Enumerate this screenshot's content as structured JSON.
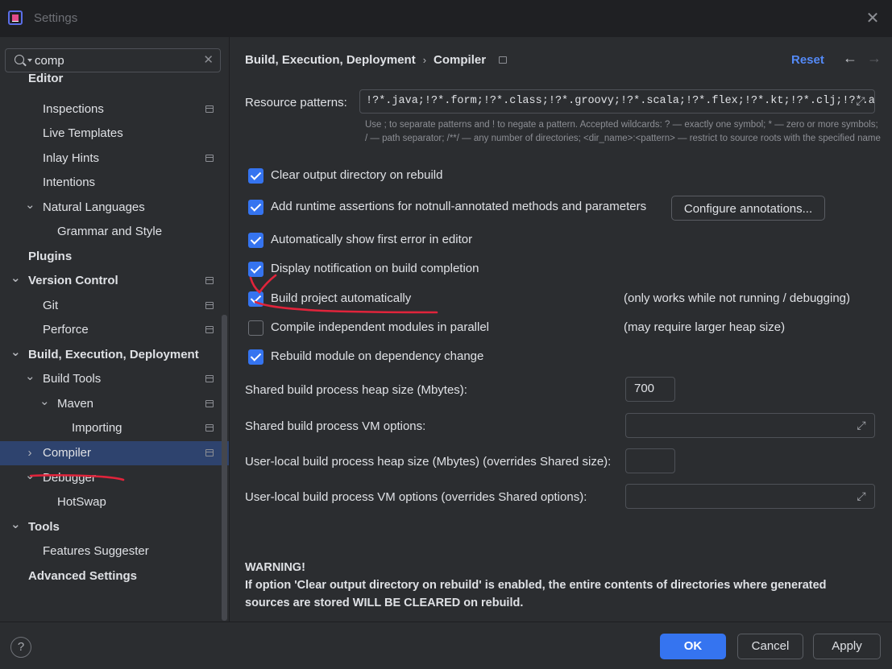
{
  "window": {
    "title": "Settings"
  },
  "search": {
    "value": "comp"
  },
  "sidebar": {
    "items": [
      {
        "label": "Editor",
        "level": 0,
        "bold": true
      },
      {
        "label": "Inspections",
        "level": 1,
        "badge": true
      },
      {
        "label": "Live Templates",
        "level": 1
      },
      {
        "label": "Inlay Hints",
        "level": 1,
        "badge": true
      },
      {
        "label": "Intentions",
        "level": 1
      },
      {
        "label": "Natural Languages",
        "level": 1,
        "expanded": true
      },
      {
        "label": "Grammar and Style",
        "level": 2
      },
      {
        "label": "Plugins",
        "level": 0,
        "bold": true
      },
      {
        "label": "Version Control",
        "level": 0,
        "bold": true,
        "expanded": true,
        "badge": true
      },
      {
        "label": "Git",
        "level": 1,
        "badge": true
      },
      {
        "label": "Perforce",
        "level": 1,
        "badge": true
      },
      {
        "label": "Build, Execution, Deployment",
        "level": 0,
        "bold": true,
        "expanded": true
      },
      {
        "label": "Build Tools",
        "level": 1,
        "expanded": true,
        "badge": true
      },
      {
        "label": "Maven",
        "level": 2,
        "expanded": true,
        "badge": true
      },
      {
        "label": "Importing",
        "level": 3,
        "badge": true
      },
      {
        "label": "Compiler",
        "level": 1,
        "collapsed": true,
        "badge": true,
        "selected": true
      },
      {
        "label": "Debugger",
        "level": 1,
        "expanded": true
      },
      {
        "label": "HotSwap",
        "level": 2
      },
      {
        "label": "Tools",
        "level": 0,
        "bold": true,
        "expanded": true
      },
      {
        "label": "Features Suggester",
        "level": 1
      },
      {
        "label": "Advanced Settings",
        "level": 0,
        "bold": true
      }
    ]
  },
  "header": {
    "crumb_parent": "Build, Execution, Deployment",
    "crumb_sep": "›",
    "crumb_current": "Compiler",
    "reset": "Reset",
    "back": "←",
    "forward": "→"
  },
  "resource": {
    "label": "Resource patterns:",
    "value": "!?*.java;!?*.form;!?*.class;!?*.groovy;!?*.scala;!?*.flex;!?*.kt;!?*.clj;!?*.aj",
    "hint": "Use ; to separate patterns and ! to negate a pattern. Accepted wildcards: ? — exactly one symbol; * — zero or more symbols; / — path separator; /**/ — any number of directories; <dir_name>:<pattern> — restrict to source roots with the specified name"
  },
  "options": [
    {
      "label": "Clear output directory on rebuild",
      "checked": true
    },
    {
      "label": "Add runtime assertions for notnull-annotated methods and parameters",
      "checked": true
    },
    {
      "label": "Automatically show first error in editor",
      "checked": true
    },
    {
      "label": "Display notification on build completion",
      "checked": true
    },
    {
      "label": "Build project automatically",
      "checked": true,
      "note": "(only works while not running / debugging)"
    },
    {
      "label": "Compile independent modules in parallel",
      "checked": false,
      "note": "(may require larger heap size)"
    },
    {
      "label": "Rebuild module on dependency change",
      "checked": true
    }
  ],
  "configure_annotations": "Configure annotations...",
  "fields": [
    {
      "label": "Shared build process heap size (Mbytes):",
      "value": "700"
    },
    {
      "label": "Shared build process VM options:",
      "value": ""
    },
    {
      "label": "User-local build process heap size (Mbytes) (overrides Shared size):",
      "value": ""
    },
    {
      "label": "User-local build process VM options (overrides Shared options):",
      "value": ""
    }
  ],
  "warning": {
    "title": "WARNING!",
    "body": "If option 'Clear output directory on rebuild' is enabled, the entire contents of directories where generated sources are stored WILL BE CLEARED on rebuild."
  },
  "footer": {
    "help": "?",
    "ok": "OK",
    "cancel": "Cancel",
    "apply": "Apply"
  },
  "colors": {
    "accent": "#3574f0",
    "link": "#548af7",
    "annotation": "#e0243b",
    "selection": "#2e436e"
  }
}
